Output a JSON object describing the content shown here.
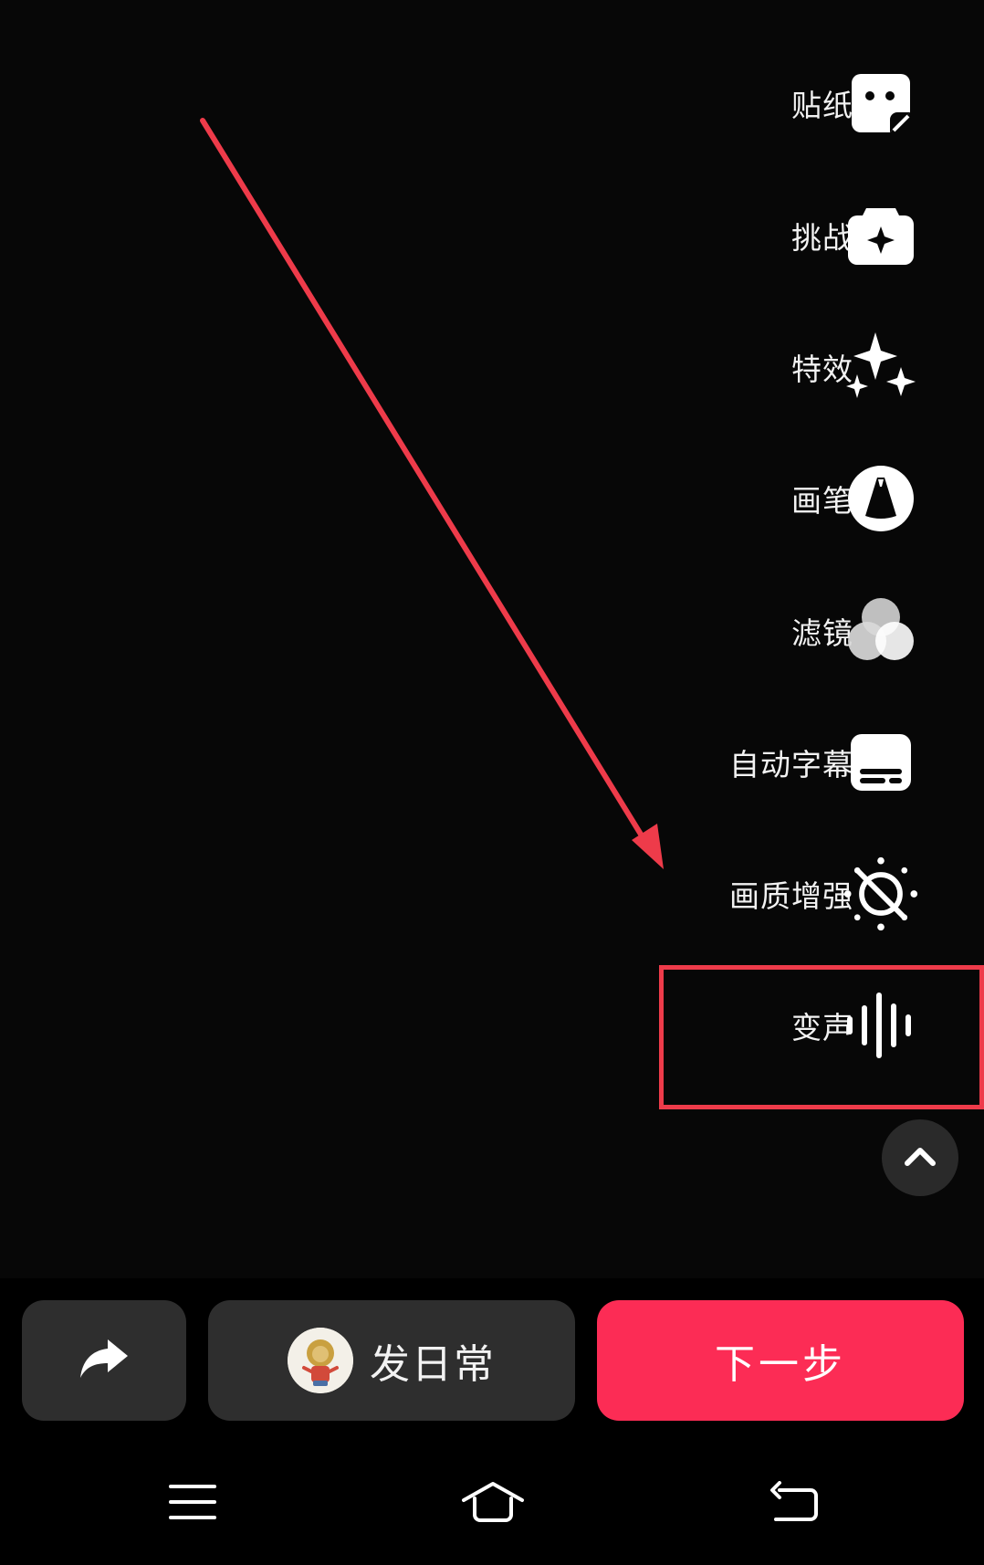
{
  "tools": [
    {
      "id": "sticker",
      "label": "贴纸",
      "icon": "sticker-icon"
    },
    {
      "id": "challenge",
      "label": "挑战",
      "icon": "challenge-icon"
    },
    {
      "id": "effects",
      "label": "特效",
      "icon": "sparkles-icon"
    },
    {
      "id": "brush",
      "label": "画笔",
      "icon": "brush-icon"
    },
    {
      "id": "filter",
      "label": "滤镜",
      "icon": "filter-icon"
    },
    {
      "id": "captions",
      "label": "自动字幕",
      "icon": "captions-icon"
    },
    {
      "id": "enhance",
      "label": "画质增强",
      "icon": "enhance-off-icon"
    },
    {
      "id": "voice",
      "label": "变声",
      "icon": "voice-wave-icon"
    }
  ],
  "bottom": {
    "daily_label": "发日常",
    "next_label": "下一步"
  },
  "colors": {
    "accent": "#fc2c55",
    "annotation": "#ee3b4a",
    "button_bg": "#2e2e2e"
  },
  "annotation": {
    "highlighted_tool": "voice"
  }
}
